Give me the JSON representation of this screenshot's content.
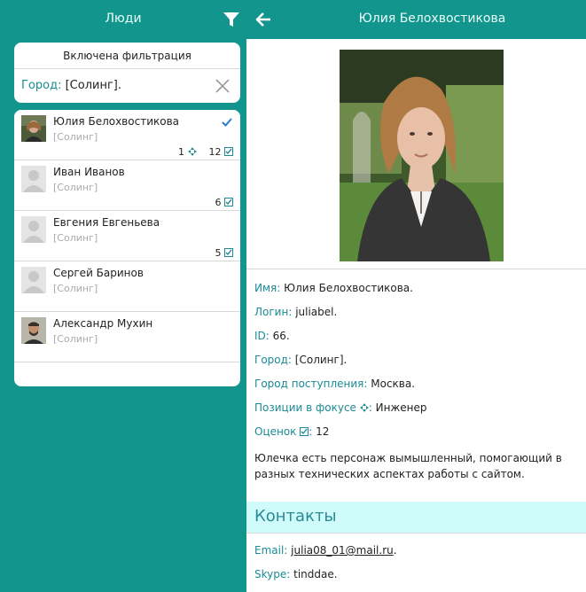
{
  "colors": {
    "teal": "#11958c",
    "label": "#1a8a95",
    "check": "#2a7dd0",
    "contacts_bg": "#cffcfb"
  },
  "left": {
    "title": "Люди",
    "filter_icon": "filter-icon",
    "filter": {
      "heading": "Включена фильтрация",
      "label": "Город:",
      "value": "[Солинг].",
      "clear_icon": "close-icon"
    },
    "people": [
      {
        "name": "Юлия Белохвостикова",
        "city": "[Солинг]",
        "selected": true,
        "focus_count": "1",
        "ratings_count": "12"
      },
      {
        "name": "Иван Иванов",
        "city": "[Солинг]",
        "selected": false,
        "ratings_count": "6"
      },
      {
        "name": "Евгения Евгеньева",
        "city": "[Солинг]",
        "selected": false,
        "ratings_count": "5"
      },
      {
        "name": "Сергей Баринов",
        "city": "[Солинг]",
        "selected": false
      },
      {
        "name": "Александр Мухин",
        "city": "[Солинг]",
        "selected": false
      }
    ]
  },
  "right": {
    "back_icon": "arrow-left-icon",
    "title": "Юлия Белохвостикова",
    "details": {
      "name_label": "Имя:",
      "name_value": "Юлия Белохвостикова.",
      "login_label": "Логин:",
      "login_value": "juliabel.",
      "id_label": "ID:",
      "id_value": "66.",
      "city_label": "Город:",
      "city_value": "[Солинг].",
      "entry_city_label": "Город поступления:",
      "entry_city_value": "Москва.",
      "focus_label": "Позиции в фокусе",
      "focus_value": "Инженер",
      "ratings_label": "Оценок",
      "ratings_value": "12",
      "about": "Юлечка есть персонаж вымышленный, помогающий в разных технических аспектах работы с сайтом."
    },
    "contacts": {
      "title": "Контакты",
      "email_label": "Email:",
      "email_value": "julia08_01@mail.ru",
      "email_suffix": ".",
      "skype_label": "Skype:",
      "skype_value": "tinddae."
    }
  }
}
